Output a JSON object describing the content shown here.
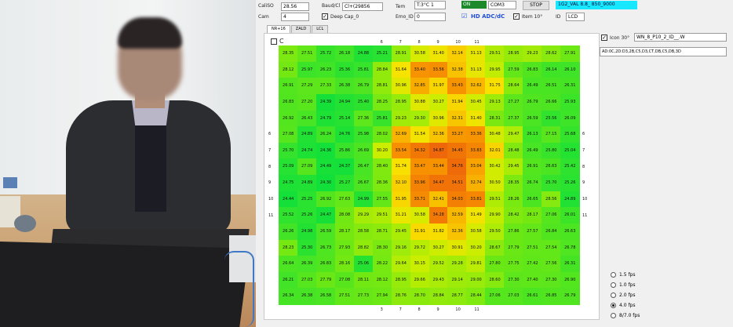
{
  "controls": {
    "caliso_label": "CaliSO",
    "caliso_value": "28.56",
    "baud_label": "Baud/Cl",
    "baud_value": "Cl+(29856",
    "temp_label": "Tem",
    "temp_value": "T:3°C 1",
    "cam_label": "Cam",
    "cam_value": "4",
    "deep_check_label": "Deep Cap_0",
    "emo_label": "Emo_ID",
    "emo_value": "0",
    "status_green_text": "ON",
    "port_value": "COM3",
    "stop_button": "STOP",
    "status_cyan_text": "1G2_VAL 8.8_ 850_9000",
    "hd_label": "HD ADC/dC",
    "item_label": "Item 10°",
    "id_label": "ID",
    "id_value": "LCD"
  },
  "tabs": [
    {
      "label": "NR+16"
    },
    {
      "label": "ZALD"
    },
    {
      "label": "LCL"
    }
  ],
  "panel": {
    "checkbox_label": "C"
  },
  "side": {
    "check_label": "Icon 30°",
    "check_value": "WN_8_P10_2_ID__.W",
    "select_value": "AD:0C,2D:D3,2B,C5,D3,CT,DB,C5,DB,3D"
  },
  "fps_options": [
    {
      "label": "1.5 fps",
      "selected": false
    },
    {
      "label": "1.0 fps",
      "selected": false
    },
    {
      "label": "2.0 fps",
      "selected": false
    },
    {
      "label": "4.0 fps",
      "selected": true
    },
    {
      "label": "8/7.0 fps",
      "selected": false
    }
  ],
  "chart_data": {
    "type": "heatmap",
    "cols": 16,
    "rows": 16,
    "top_labels": [
      {
        "col": 6,
        "text": "6"
      },
      {
        "col": 7,
        "text": "7"
      },
      {
        "col": 8,
        "text": "8"
      },
      {
        "col": 9,
        "text": "9"
      },
      {
        "col": 10,
        "text": "10"
      },
      {
        "col": 11,
        "text": "11"
      }
    ],
    "bottom_labels": [
      {
        "col": 6,
        "text": "3"
      },
      {
        "col": 7,
        "text": "7"
      },
      {
        "col": 8,
        "text": "8"
      },
      {
        "col": 9,
        "text": "9"
      },
      {
        "col": 10,
        "text": "10"
      },
      {
        "col": 11,
        "text": "11"
      }
    ],
    "left_labels": [
      {
        "row": 5,
        "text": "6"
      },
      {
        "row": 6,
        "text": "7"
      },
      {
        "row": 7,
        "text": "8"
      },
      {
        "row": 8,
        "text": "9"
      },
      {
        "row": 9,
        "text": "10"
      },
      {
        "row": 10,
        "text": "11"
      }
    ],
    "right_labels": [
      {
        "row": 5,
        "text": "6"
      },
      {
        "row": 6,
        "text": "7"
      },
      {
        "row": 7,
        "text": "8"
      },
      {
        "row": 8,
        "text": "9"
      },
      {
        "row": 9,
        "text": "10"
      },
      {
        "row": 10,
        "text": "11"
      }
    ],
    "values": [
      [
        28.35,
        27.51,
        25.72,
        26.18,
        24.88,
        25.21,
        28.91,
        30.58,
        31.4,
        32.14,
        31.13,
        29.51,
        28.95,
        29.23,
        28.62,
        27.91
      ],
      [
        28.12,
        25.97,
        26.23,
        25.36,
        25.81,
        28.84,
        31.64,
        33.4,
        33.56,
        32.38,
        31.13,
        29.95,
        27.59,
        26.83,
        26.14,
        26.1
      ],
      [
        26.91,
        27.29,
        27.33,
        26.38,
        26.79,
        28.81,
        30.96,
        32.85,
        31.97,
        33.43,
        32.62,
        31.75,
        28.64,
        26.49,
        26.51,
        26.31
      ],
      [
        26.83,
        27.2,
        24.39,
        24.94,
        25.4,
        28.25,
        28.95,
        30.88,
        30.27,
        31.94,
        30.45,
        29.13,
        27.27,
        26.79,
        26.66,
        25.93
      ],
      [
        26.92,
        26.43,
        24.79,
        25.14,
        27.36,
        25.81,
        29.23,
        29.3,
        30.96,
        32.31,
        31.4,
        28.31,
        27.37,
        26.59,
        25.56,
        26.09
      ],
      [
        27.08,
        24.89,
        26.24,
        24.76,
        25.98,
        28.02,
        32.69,
        31.54,
        32.36,
        33.27,
        33.36,
        30.48,
        29.47,
        26.13,
        27.15,
        25.68
      ],
      [
        25.7,
        24.74,
        24.36,
        25.86,
        26.69,
        30.2,
        33.54,
        34.32,
        34.87,
        34.45,
        33.83,
        32.01,
        28.48,
        26.49,
        25.8,
        25.04
      ],
      [
        25.09,
        27.09,
        24.49,
        24.37,
        26.47,
        28.4,
        31.74,
        33.47,
        33.44,
        34.76,
        33.04,
        30.42,
        29.45,
        26.91,
        26.63,
        25.42
      ],
      [
        24.75,
        24.89,
        24.3,
        25.27,
        26.67,
        28.36,
        32.1,
        33.96,
        34.47,
        34.51,
        32.74,
        30.5,
        28.35,
        26.74,
        25.7,
        25.26
      ],
      [
        24.44,
        25.25,
        26.92,
        27.63,
        24.99,
        27.55,
        31.95,
        33.71,
        32.41,
        34.03,
        33.81,
        29.51,
        28.26,
        26.65,
        28.56,
        24.89
      ],
      [
        25.52,
        25.26,
        24.47,
        28.08,
        29.29,
        29.51,
        31.21,
        30.58,
        34.28,
        32.59,
        31.49,
        29.9,
        28.42,
        28.17,
        27.06,
        26.01
      ],
      [
        26.26,
        24.98,
        26.59,
        28.17,
        28.58,
        28.71,
        29.45,
        31.91,
        31.82,
        32.36,
        30.58,
        29.5,
        27.86,
        27.57,
        26.84,
        26.63
      ],
      [
        28.23,
        25.3,
        26.73,
        27.93,
        28.82,
        28.3,
        29.16,
        29.72,
        30.27,
        30.91,
        30.2,
        28.67,
        27.79,
        27.51,
        27.54,
        26.78
      ],
      [
        26.64,
        26.39,
        26.83,
        28.16,
        25.06,
        28.22,
        29.64,
        30.15,
        29.52,
        29.28,
        29.81,
        27.8,
        27.75,
        27.42,
        27.56,
        26.31
      ],
      [
        26.21,
        27.03,
        27.79,
        27.08,
        28.11,
        28.12,
        28.95,
        29.66,
        29.43,
        29.14,
        29.0,
        28.6,
        27.3,
        27.4,
        27.3,
        26.9
      ],
      [
        26.34,
        26.38,
        26.58,
        27.51,
        27.73,
        27.94,
        28.76,
        28.7,
        28.84,
        28.77,
        28.44,
        27.06,
        27.03,
        26.61,
        26.85,
        26.79
      ]
    ]
  }
}
